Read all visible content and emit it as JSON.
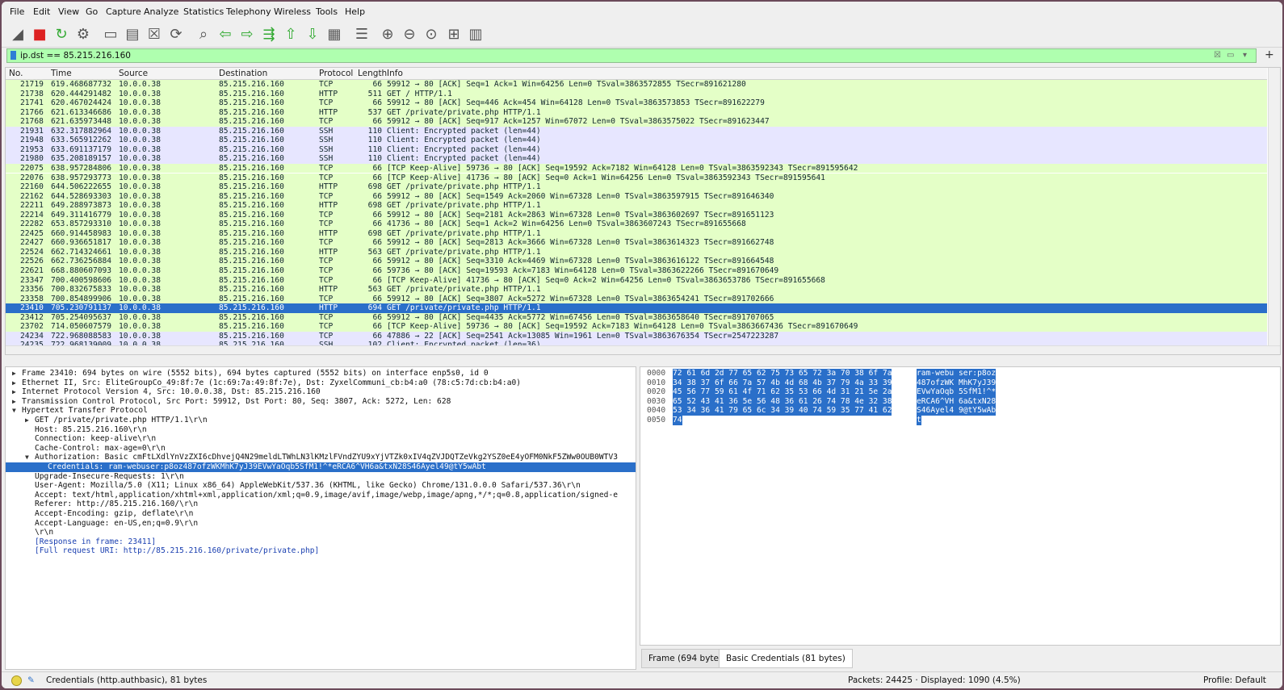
{
  "menu": [
    "File",
    "Edit",
    "View",
    "Go",
    "Capture",
    "Analyze",
    "Statistics",
    "Telephony",
    "Wireless",
    "Tools",
    "Help"
  ],
  "toolbar_icons": [
    "shark-fin-start-icon",
    "stop-icon",
    "restart-icon",
    "capture-options-icon",
    "open-file-icon",
    "save-file-icon",
    "close-file-icon",
    "reload-icon",
    "find-packet-icon",
    "go-back-icon",
    "go-forward-icon",
    "go-to-packet-icon",
    "first-packet-icon",
    "last-packet-icon",
    "autoscroll-icon",
    "colorize-icon",
    "zoom-in-icon",
    "zoom-out-icon",
    "normal-size-icon",
    "resize-columns-icon",
    "layout-icon"
  ],
  "filter": {
    "value": "ip.dst == 85.215.216.160",
    "bg_color": "#afffaf"
  },
  "columns": [
    "No.",
    "Time",
    "Source",
    "Destination",
    "Protocol",
    "Length",
    "Info"
  ],
  "packets": [
    {
      "no": "21719",
      "time": "619.468687732",
      "src": "10.0.0.38",
      "dst": "85.215.216.160",
      "proto": "TCP",
      "len": "66",
      "info": "59912 → 80 [ACK] Seq=1 Ack=1 Win=64256 Len=0 TSval=3863572855 TSecr=891621280",
      "cls": "tcp"
    },
    {
      "no": "21738",
      "time": "620.444291482",
      "src": "10.0.0.38",
      "dst": "85.215.216.160",
      "proto": "HTTP",
      "len": "511",
      "info": "GET / HTTP/1.1",
      "cls": "tcp"
    },
    {
      "no": "21741",
      "time": "620.467024424",
      "src": "10.0.0.38",
      "dst": "85.215.216.160",
      "proto": "TCP",
      "len": "66",
      "info": "59912 → 80 [ACK] Seq=446 Ack=454 Win=64128 Len=0 TSval=3863573853 TSecr=891622279",
      "cls": "tcp"
    },
    {
      "no": "21766",
      "time": "621.613346686",
      "src": "10.0.0.38",
      "dst": "85.215.216.160",
      "proto": "HTTP",
      "len": "537",
      "info": "GET /private/private.php HTTP/1.1",
      "cls": "tcp"
    },
    {
      "no": "21768",
      "time": "621.635973448",
      "src": "10.0.0.38",
      "dst": "85.215.216.160",
      "proto": "TCP",
      "len": "66",
      "info": "59912 → 80 [ACK] Seq=917 Ack=1257 Win=67072 Len=0 TSval=3863575022 TSecr=891623447",
      "cls": "tcp"
    },
    {
      "no": "21931",
      "time": "632.317882964",
      "src": "10.0.0.38",
      "dst": "85.215.216.160",
      "proto": "SSH",
      "len": "110",
      "info": "Client: Encrypted packet (len=44)",
      "cls": "ssh"
    },
    {
      "no": "21948",
      "time": "633.565912262",
      "src": "10.0.0.38",
      "dst": "85.215.216.160",
      "proto": "SSH",
      "len": "110",
      "info": "Client: Encrypted packet (len=44)",
      "cls": "ssh"
    },
    {
      "no": "21953",
      "time": "633.691137179",
      "src": "10.0.0.38",
      "dst": "85.215.216.160",
      "proto": "SSH",
      "len": "110",
      "info": "Client: Encrypted packet (len=44)",
      "cls": "ssh"
    },
    {
      "no": "21980",
      "time": "635.208189157",
      "src": "10.0.0.38",
      "dst": "85.215.216.160",
      "proto": "SSH",
      "len": "110",
      "info": "Client: Encrypted packet (len=44)",
      "cls": "ssh"
    },
    {
      "no": "22075",
      "time": "638.957284806",
      "src": "10.0.0.38",
      "dst": "85.215.216.160",
      "proto": "TCP",
      "len": "66",
      "info": "[TCP Keep-Alive] 59736 → 80 [ACK] Seq=19592 Ack=7182 Win=64128 Len=0 TSval=3863592343 TSecr=891595642",
      "cls": "tcp"
    },
    {
      "no": "22076",
      "time": "638.957293773",
      "src": "10.0.0.38",
      "dst": "85.215.216.160",
      "proto": "TCP",
      "len": "66",
      "info": "[TCP Keep-Alive] 41736 → 80 [ACK] Seq=0 Ack=1 Win=64256 Len=0 TSval=3863592343 TSecr=891595641",
      "cls": "tcp"
    },
    {
      "no": "22160",
      "time": "644.506222655",
      "src": "10.0.0.38",
      "dst": "85.215.216.160",
      "proto": "HTTP",
      "len": "698",
      "info": "GET /private/private.php HTTP/1.1",
      "cls": "tcp"
    },
    {
      "no": "22162",
      "time": "644.528693303",
      "src": "10.0.0.38",
      "dst": "85.215.216.160",
      "proto": "TCP",
      "len": "66",
      "info": "59912 → 80 [ACK] Seq=1549 Ack=2060 Win=67328 Len=0 TSval=3863597915 TSecr=891646340",
      "cls": "tcp"
    },
    {
      "no": "22211",
      "time": "649.288973873",
      "src": "10.0.0.38",
      "dst": "85.215.216.160",
      "proto": "HTTP",
      "len": "698",
      "info": "GET /private/private.php HTTP/1.1",
      "cls": "tcp"
    },
    {
      "no": "22214",
      "time": "649.311416779",
      "src": "10.0.0.38",
      "dst": "85.215.216.160",
      "proto": "TCP",
      "len": "66",
      "info": "59912 → 80 [ACK] Seq=2181 Ack=2863 Win=67328 Len=0 TSval=3863602697 TSecr=891651123",
      "cls": "tcp"
    },
    {
      "no": "22282",
      "time": "653.857293310",
      "src": "10.0.0.38",
      "dst": "85.215.216.160",
      "proto": "TCP",
      "len": "66",
      "info": "41736 → 80 [ACK] Seq=1 Ack=2 Win=64256 Len=0 TSval=3863607243 TSecr=891655668",
      "cls": "tcp"
    },
    {
      "no": "22425",
      "time": "660.914458983",
      "src": "10.0.0.38",
      "dst": "85.215.216.160",
      "proto": "HTTP",
      "len": "698",
      "info": "GET /private/private.php HTTP/1.1",
      "cls": "tcp"
    },
    {
      "no": "22427",
      "time": "660.936651817",
      "src": "10.0.0.38",
      "dst": "85.215.216.160",
      "proto": "TCP",
      "len": "66",
      "info": "59912 → 80 [ACK] Seq=2813 Ack=3666 Win=67328 Len=0 TSval=3863614323 TSecr=891662748",
      "cls": "tcp"
    },
    {
      "no": "22524",
      "time": "662.714324661",
      "src": "10.0.0.38",
      "dst": "85.215.216.160",
      "proto": "HTTP",
      "len": "563",
      "info": "GET /private/private.php HTTP/1.1",
      "cls": "tcp"
    },
    {
      "no": "22526",
      "time": "662.736256884",
      "src": "10.0.0.38",
      "dst": "85.215.216.160",
      "proto": "TCP",
      "len": "66",
      "info": "59912 → 80 [ACK] Seq=3310 Ack=4469 Win=67328 Len=0 TSval=3863616122 TSecr=891664548",
      "cls": "tcp"
    },
    {
      "no": "22621",
      "time": "668.880607093",
      "src": "10.0.0.38",
      "dst": "85.215.216.160",
      "proto": "TCP",
      "len": "66",
      "info": "59736 → 80 [ACK] Seq=19593 Ack=7183 Win=64128 Len=0 TSval=3863622266 TSecr=891670649",
      "cls": "tcp"
    },
    {
      "no": "23347",
      "time": "700.400598606",
      "src": "10.0.0.38",
      "dst": "85.215.216.160",
      "proto": "TCP",
      "len": "66",
      "info": "[TCP Keep-Alive] 41736 → 80 [ACK] Seq=0 Ack=2 Win=64256 Len=0 TSval=3863653786 TSecr=891655668",
      "cls": "tcp"
    },
    {
      "no": "23356",
      "time": "700.832675833",
      "src": "10.0.0.38",
      "dst": "85.215.216.160",
      "proto": "HTTP",
      "len": "563",
      "info": "GET /private/private.php HTTP/1.1",
      "cls": "tcp"
    },
    {
      "no": "23358",
      "time": "700.854899906",
      "src": "10.0.0.38",
      "dst": "85.215.216.160",
      "proto": "TCP",
      "len": "66",
      "info": "59912 → 80 [ACK] Seq=3807 Ack=5272 Win=67328 Len=0 TSval=3863654241 TSecr=891702666",
      "cls": "tcp"
    },
    {
      "no": "23410",
      "time": "705.230791137",
      "src": "10.0.0.38",
      "dst": "85.215.216.160",
      "proto": "HTTP",
      "len": "694",
      "info": "GET /private/private.php HTTP/1.1",
      "cls": "sel"
    },
    {
      "no": "23412",
      "time": "705.254095637",
      "src": "10.0.0.38",
      "dst": "85.215.216.160",
      "proto": "TCP",
      "len": "66",
      "info": "59912 → 80 [ACK] Seq=4435 Ack=5772 Win=67456 Len=0 TSval=3863658640 TSecr=891707065",
      "cls": "tcp"
    },
    {
      "no": "23702",
      "time": "714.050607579",
      "src": "10.0.0.38",
      "dst": "85.215.216.160",
      "proto": "TCP",
      "len": "66",
      "info": "[TCP Keep-Alive] 59736 → 80 [ACK] Seq=19592 Ack=7183 Win=64128 Len=0 TSval=3863667436 TSecr=891670649",
      "cls": "tcp"
    },
    {
      "no": "24234",
      "time": "722.968088583",
      "src": "10.0.0.38",
      "dst": "85.215.216.160",
      "proto": "TCP",
      "len": "66",
      "info": "47886 → 22 [ACK] Seq=2541 Ack=13085 Win=1961 Len=0 TSval=3863676354 TSecr=2547223287",
      "cls": "ssh"
    },
    {
      "no": "24235",
      "time": "722.968139009",
      "src": "10.0.0.38",
      "dst": "85.215.216.160",
      "proto": "SSH",
      "len": "102",
      "info": "Client: Encrypted packet (len=36)",
      "cls": "ssh"
    }
  ],
  "details": [
    {
      "arrow": "▶",
      "indent": 0,
      "text": "Frame 23410: 694 bytes on wire (5552 bits), 694 bytes captured (5552 bits) on interface enp5s0, id 0",
      "cls": ""
    },
    {
      "arrow": "▶",
      "indent": 0,
      "text": "Ethernet II, Src: EliteGroupCo_49:8f:7e (1c:69:7a:49:8f:7e), Dst: ZyxelCommuni_cb:b4:a0 (78:c5:7d:cb:b4:a0)",
      "cls": ""
    },
    {
      "arrow": "▶",
      "indent": 0,
      "text": "Internet Protocol Version 4, Src: 10.0.0.38, Dst: 85.215.216.160",
      "cls": ""
    },
    {
      "arrow": "▶",
      "indent": 0,
      "text": "Transmission Control Protocol, Src Port: 59912, Dst Port: 80, Seq: 3807, Ack: 5272, Len: 628",
      "cls": ""
    },
    {
      "arrow": "▼",
      "indent": 0,
      "text": "Hypertext Transfer Protocol",
      "cls": ""
    },
    {
      "arrow": "▶",
      "indent": 1,
      "text": "GET /private/private.php HTTP/1.1\\r\\n",
      "cls": ""
    },
    {
      "arrow": "",
      "indent": 1,
      "text": "Host: 85.215.216.160\\r\\n",
      "cls": ""
    },
    {
      "arrow": "",
      "indent": 1,
      "text": "Connection: keep-alive\\r\\n",
      "cls": ""
    },
    {
      "arrow": "",
      "indent": 1,
      "text": "Cache-Control: max-age=0\\r\\n",
      "cls": ""
    },
    {
      "arrow": "▼",
      "indent": 1,
      "text": "Authorization: Basic cmFtLXdlYnVzZXI6cDhvejQ4N29meldLTWhLN3lKMzlFVndZYU9xYjVTZk0xIV4qZVJDQTZeVkg2YSZ0eE4yOFM0NkF5ZWw0OUB0WTV3",
      "cls": ""
    },
    {
      "arrow": "",
      "indent": 2,
      "text": "Credentials: ram-webuser:p8oz487ofzWKMhK7yJ39EVwYaOqb5SfM1!^*eRCA6^VH6a&txN28S46Ayel49@tY5wAbt",
      "cls": "sel"
    },
    {
      "arrow": "",
      "indent": 1,
      "text": "Upgrade-Insecure-Requests: 1\\r\\n",
      "cls": ""
    },
    {
      "arrow": "",
      "indent": 1,
      "text": "User-Agent: Mozilla/5.0 (X11; Linux x86_64) AppleWebKit/537.36 (KHTML, like Gecko) Chrome/131.0.0.0 Safari/537.36\\r\\n",
      "cls": ""
    },
    {
      "arrow": "",
      "indent": 1,
      "text": "Accept: text/html,application/xhtml+xml,application/xml;q=0.9,image/avif,image/webp,image/apng,*/*;q=0.8,application/signed-e",
      "cls": ""
    },
    {
      "arrow": "",
      "indent": 1,
      "text": "Referer: http://85.215.216.160/\\r\\n",
      "cls": ""
    },
    {
      "arrow": "",
      "indent": 1,
      "text": "Accept-Encoding: gzip, deflate\\r\\n",
      "cls": ""
    },
    {
      "arrow": "",
      "indent": 1,
      "text": "Accept-Language: en-US,en;q=0.9\\r\\n",
      "cls": ""
    },
    {
      "arrow": "",
      "indent": 1,
      "text": "\\r\\n",
      "cls": ""
    },
    {
      "arrow": "",
      "indent": 1,
      "text": "[Response in frame: 23411]",
      "cls": "link"
    },
    {
      "arrow": "",
      "indent": 1,
      "text": "[Full request URI: http://85.215.216.160/private/private.php]",
      "cls": "link"
    }
  ],
  "hex": [
    {
      "off": "0000",
      "hex": "72 61 6d 2d 77 65 62 75  73 65 72 3a 70 38 6f 7a",
      "ascii": "ram-webu ser:p8oz"
    },
    {
      "off": "0010",
      "hex": "34 38 37 6f 66 7a 57 4b  4d 68 4b 37 79 4a 33 39",
      "ascii": "487ofzWK MhK7yJ39"
    },
    {
      "off": "0020",
      "hex": "45 56 77 59 61 4f 71 62  35 53 66 4d 31 21 5e 2a",
      "ascii": "EVwYaOqb 5SfM1!^*"
    },
    {
      "off": "0030",
      "hex": "65 52 43 41 36 5e 56 48  36 61 26 74 78 4e 32 38",
      "ascii": "eRCA6^VH 6a&txN28"
    },
    {
      "off": "0040",
      "hex": "53 34 36 41 79 65 6c 34  39 40 74 59 35 77 41 62",
      "ascii": "S46Ayel4 9@tY5wAb"
    },
    {
      "off": "0050",
      "hex": "74",
      "ascii": "t"
    }
  ],
  "byte_tabs": [
    "Frame (694 bytes)",
    "Basic Credentials (81 bytes)"
  ],
  "status": {
    "left": "Credentials (http.authbasic), 81 bytes",
    "packets": "Packets: 24425 · Displayed: 1090 (4.5%)",
    "profile": "Profile: Default"
  }
}
